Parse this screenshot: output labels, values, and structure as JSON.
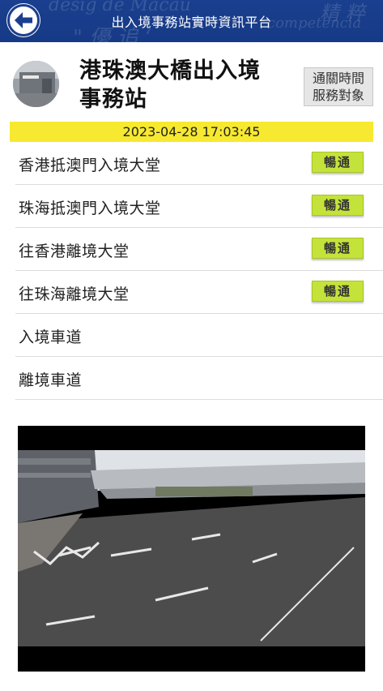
{
  "header": {
    "title": "出入境事務站實時資訊平台",
    "back_icon": "back-arrow-icon",
    "color": "#1a3f8e"
  },
  "station": {
    "name": "港珠澳大橋出入境事務站",
    "service_links": [
      "通關時間",
      "服務對象"
    ]
  },
  "timestamp": "2023-04-28 17:03:45",
  "halls": [
    {
      "label": "香港抵澳門入境大堂",
      "status": "暢通"
    },
    {
      "label": "珠海抵澳門入境大堂",
      "status": "暢通"
    },
    {
      "label": "往香港離境大堂",
      "status": "暢通"
    },
    {
      "label": "往珠海離境大堂",
      "status": "暢通"
    },
    {
      "label": "入境車道",
      "status": null
    },
    {
      "label": "離境車道",
      "status": null
    }
  ],
  "colors": {
    "status_ok": "#c4e33a",
    "timestamp_bg": "#f7e930"
  }
}
